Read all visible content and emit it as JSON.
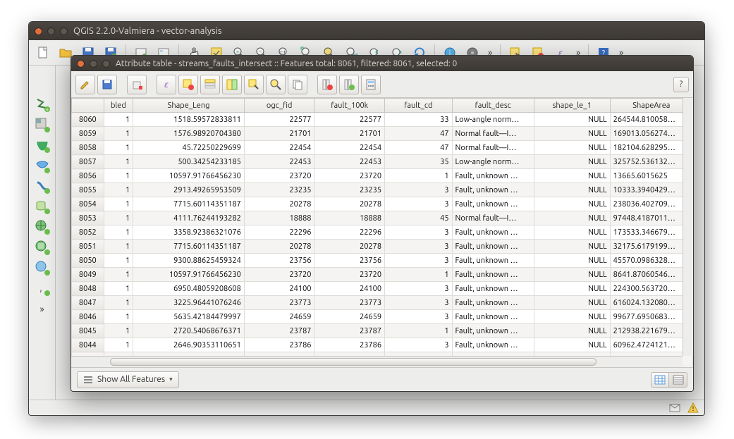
{
  "main_window": {
    "title": "QGIS 2.2.0-Valmiera - vector-analysis"
  },
  "attr_window": {
    "title": "Attribute table - streams_faults_intersect :: Features total: 8061, filtered: 8061, selected: 0",
    "help_label": "?",
    "show_all_label": "Show All Features"
  },
  "columns": [
    "bled",
    "Shape_Leng",
    "ogc_fid",
    "fault_100k",
    "fault_cd",
    "fault_desc",
    "shape_le_1",
    "ShapeArea"
  ],
  "rows": [
    {
      "id": "8060",
      "bled": "1",
      "shape_leng": "1518.59572833811",
      "ogc_fid": "22577",
      "fault_100k": "22577",
      "fault_cd": "33",
      "fault_desc": "Low-angle norm…",
      "shape_le_1": "NULL",
      "shape_area": "264544.810058…"
    },
    {
      "id": "8059",
      "bled": "1",
      "shape_leng": "1576.98920704380",
      "ogc_fid": "21701",
      "fault_100k": "21701",
      "fault_cd": "47",
      "fault_desc": "Normal fault—I…",
      "shape_le_1": "NULL",
      "shape_area": "169013.056274…"
    },
    {
      "id": "8058",
      "bled": "1",
      "shape_leng": "45.72250229699",
      "ogc_fid": "22454",
      "fault_100k": "22454",
      "fault_cd": "47",
      "fault_desc": "Normal fault—I…",
      "shape_le_1": "NULL",
      "shape_area": "182104.628295…"
    },
    {
      "id": "8057",
      "bled": "1",
      "shape_leng": "500.34254233185",
      "ogc_fid": "22453",
      "fault_100k": "22453",
      "fault_cd": "35",
      "fault_desc": "Low-angle norm…",
      "shape_le_1": "NULL",
      "shape_area": "325752.536132…"
    },
    {
      "id": "8056",
      "bled": "1",
      "shape_leng": "10597.91766456230",
      "ogc_fid": "23720",
      "fault_100k": "23720",
      "fault_cd": "1",
      "fault_desc": "Fault, unknown …",
      "shape_le_1": "NULL",
      "shape_area": "13665.6015625"
    },
    {
      "id": "8055",
      "bled": "1",
      "shape_leng": "2913.49265953509",
      "ogc_fid": "23235",
      "fault_100k": "23235",
      "fault_cd": "3",
      "fault_desc": "Fault, unknown …",
      "shape_le_1": "NULL",
      "shape_area": "10333.3940429…"
    },
    {
      "id": "8054",
      "bled": "1",
      "shape_leng": "7715.60114351187",
      "ogc_fid": "20278",
      "fault_100k": "20278",
      "fault_cd": "3",
      "fault_desc": "Fault, unknown …",
      "shape_le_1": "NULL",
      "shape_area": "238036.402709…"
    },
    {
      "id": "8053",
      "bled": "1",
      "shape_leng": "4111.76244193282",
      "ogc_fid": "18888",
      "fault_100k": "18888",
      "fault_cd": "45",
      "fault_desc": "Normal fault—I…",
      "shape_le_1": "NULL",
      "shape_area": "97448.4187011…"
    },
    {
      "id": "8052",
      "bled": "1",
      "shape_leng": "3358.92386321076",
      "ogc_fid": "22296",
      "fault_100k": "22296",
      "fault_cd": "3",
      "fault_desc": "Fault, unknown …",
      "shape_le_1": "NULL",
      "shape_area": "173533.346679…"
    },
    {
      "id": "8051",
      "bled": "1",
      "shape_leng": "7715.60114351187",
      "ogc_fid": "20278",
      "fault_100k": "20278",
      "fault_cd": "3",
      "fault_desc": "Fault, unknown …",
      "shape_le_1": "NULL",
      "shape_area": "32175.6179199…"
    },
    {
      "id": "8050",
      "bled": "1",
      "shape_leng": "9300.88625459324",
      "ogc_fid": "23756",
      "fault_100k": "23756",
      "fault_cd": "3",
      "fault_desc": "Fault, unknown …",
      "shape_le_1": "NULL",
      "shape_area": "45570.0986328…"
    },
    {
      "id": "8049",
      "bled": "1",
      "shape_leng": "10597.91766456230",
      "ogc_fid": "23720",
      "fault_100k": "23720",
      "fault_cd": "1",
      "fault_desc": "Fault, unknown …",
      "shape_le_1": "NULL",
      "shape_area": "8641.87060546…"
    },
    {
      "id": "8048",
      "bled": "1",
      "shape_leng": "6950.48059208608",
      "ogc_fid": "24100",
      "fault_100k": "24100",
      "fault_cd": "3",
      "fault_desc": "Fault, unknown …",
      "shape_le_1": "NULL",
      "shape_area": "224300.563720…"
    },
    {
      "id": "8047",
      "bled": "1",
      "shape_leng": "3225.96441076246",
      "ogc_fid": "23773",
      "fault_100k": "23773",
      "fault_cd": "3",
      "fault_desc": "Fault, unknown …",
      "shape_le_1": "NULL",
      "shape_area": "616024.132080…"
    },
    {
      "id": "8046",
      "bled": "1",
      "shape_leng": "5635.42184479997",
      "ogc_fid": "24659",
      "fault_100k": "24659",
      "fault_cd": "3",
      "fault_desc": "Fault, unknown …",
      "shape_le_1": "NULL",
      "shape_area": "99677.6950683…"
    },
    {
      "id": "8045",
      "bled": "1",
      "shape_leng": "2720.54068676371",
      "ogc_fid": "23787",
      "fault_100k": "23787",
      "fault_cd": "1",
      "fault_desc": "Fault, unknown …",
      "shape_le_1": "NULL",
      "shape_area": "212938.221679…"
    },
    {
      "id": "8044",
      "bled": "1",
      "shape_leng": "2646.90353110651",
      "ogc_fid": "23786",
      "fault_100k": "23786",
      "fault_cd": "3",
      "fault_desc": "Fault, unknown …",
      "shape_le_1": "NULL",
      "shape_area": "60962.4724121…"
    }
  ],
  "partial_row": {
    "id": "",
    "bled": "1",
    "shape_leng": "",
    "ogc_fid": "",
    "fault_100k": "",
    "fault_cd": "",
    "fault_desc": "",
    "shape_le_1": "NULL",
    "shape_area": ""
  }
}
